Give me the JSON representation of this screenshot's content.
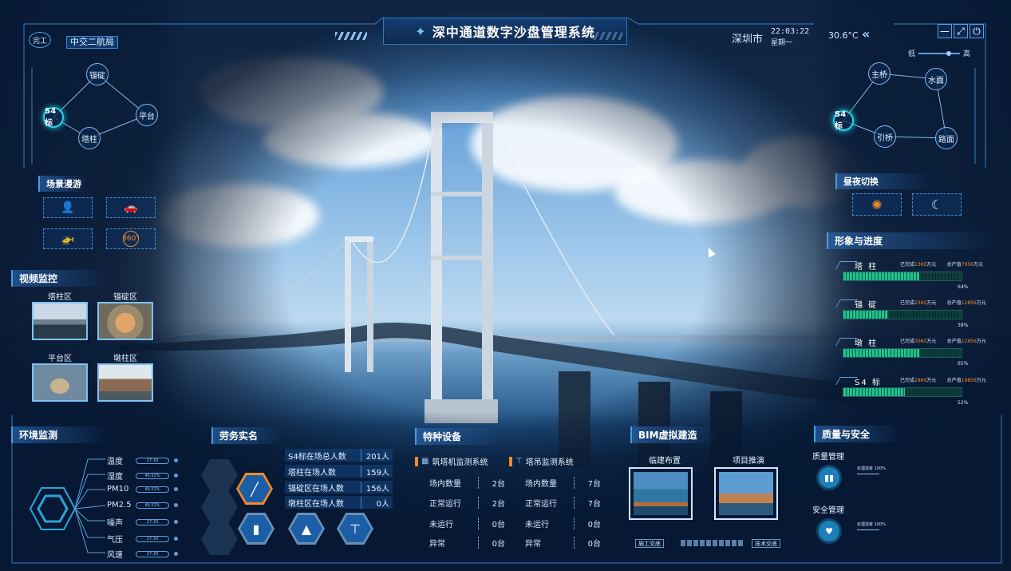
{
  "header": {
    "title": "深中通道数字沙盘管理系统",
    "badge": "完工",
    "org": "中交二航局",
    "city": "深圳市",
    "time": "22:03:22",
    "weekday": "星期一",
    "temperature": "30.6°C",
    "collapse_icon": "«",
    "controls": [
      "—",
      "⤢",
      "⏻"
    ],
    "brightness": {
      "low": "低",
      "high": "高",
      "level": 0.73
    }
  },
  "left_graph": {
    "nodes": [
      {
        "label": "锚碇",
        "active": false
      },
      {
        "label": "平台",
        "active": false
      },
      {
        "label": "S4标",
        "active": true
      },
      {
        "label": "塔柱",
        "active": false
      }
    ]
  },
  "right_graph": {
    "nodes": [
      {
        "label": "主桥",
        "active": false
      },
      {
        "label": "水面",
        "active": false
      },
      {
        "label": "S4标",
        "active": true
      },
      {
        "label": "引桥",
        "active": false
      },
      {
        "label": "路面",
        "active": false
      }
    ]
  },
  "tour": {
    "title": "场景漫游",
    "buttons": [
      "person-icon",
      "car-icon",
      "helicopter-icon",
      "360-icon"
    ],
    "label_360": "360°"
  },
  "video": {
    "title": "视频监控",
    "cams": [
      {
        "label": "塔柱区"
      },
      {
        "label": "锚碇区"
      },
      {
        "label": "平台区"
      },
      {
        "label": "墩柱区"
      }
    ]
  },
  "environment": {
    "title": "环境监测",
    "rows": [
      {
        "label": "温度",
        "value": "27.30"
      },
      {
        "label": "湿度",
        "value": "46.52%"
      },
      {
        "label": "PM10",
        "value": "46.52%"
      },
      {
        "label": "PM2.5",
        "value": "46.52%"
      },
      {
        "label": "噪声",
        "value": "27.30"
      },
      {
        "label": "气压",
        "value": "27.30"
      },
      {
        "label": "风速",
        "value": "27.30"
      }
    ]
  },
  "labor": {
    "title": "劳务实名",
    "rows": [
      {
        "label": "S4标在场总人数",
        "value": "201人"
      },
      {
        "label": "塔柱在场人数",
        "value": "159人"
      },
      {
        "label": "锚碇区在场人数",
        "value": "156人"
      },
      {
        "label": "墩柱区在场人数",
        "value": "0人"
      }
    ]
  },
  "equipment": {
    "title": "特种设备",
    "groups": [
      {
        "name": "筑塔机监测系统",
        "rows": [
          {
            "label": "场内数量",
            "value": "2台"
          },
          {
            "label": "正常运行",
            "value": "2台"
          },
          {
            "label": "未运行",
            "value": "0台"
          },
          {
            "label": "异常",
            "value": "0台"
          }
        ]
      },
      {
        "name": "塔吊监测系统",
        "rows": [
          {
            "label": "场内数量",
            "value": "7台"
          },
          {
            "label": "正常运行",
            "value": "7台"
          },
          {
            "label": "未运行",
            "value": "0台"
          },
          {
            "label": "异常",
            "value": "0台"
          }
        ]
      }
    ]
  },
  "bim": {
    "title": "BIM虚拟建造",
    "items": [
      {
        "label": "临建布置"
      },
      {
        "label": "项目推演"
      }
    ],
    "foot_left": "施工交底",
    "foot_right": "技术交底"
  },
  "quality": {
    "title": "质量与安全",
    "items": [
      {
        "label": "质量管理",
        "progress_label": "处理进度",
        "progress": "100%"
      },
      {
        "label": "安全管理",
        "progress_label": "处理进度",
        "progress": "100%"
      }
    ]
  },
  "daynight": {
    "title": "昼夜切换"
  },
  "progress": {
    "title": "形象与进度",
    "done_prefix": "已完成",
    "total_prefix": "总产值",
    "unit": "万元",
    "rows": [
      {
        "name": "塔 柱",
        "done": "1360",
        "total": "7956",
        "pct": "64%",
        "fraction": 0.64
      },
      {
        "name": "锚 碇",
        "done": "2360",
        "total": "12856",
        "pct": "38%",
        "fraction": 0.38
      },
      {
        "name": "墩 柱",
        "done": "3060",
        "total": "12856",
        "pct": "65%",
        "fraction": 0.65
      },
      {
        "name": "S4 标",
        "done": "2860",
        "total": "19856",
        "pct": "52%",
        "fraction": 0.52
      }
    ]
  },
  "colors": {
    "accent": "#23d4e6",
    "progress": "#1fc28c",
    "highlight": "#f08a2a"
  }
}
